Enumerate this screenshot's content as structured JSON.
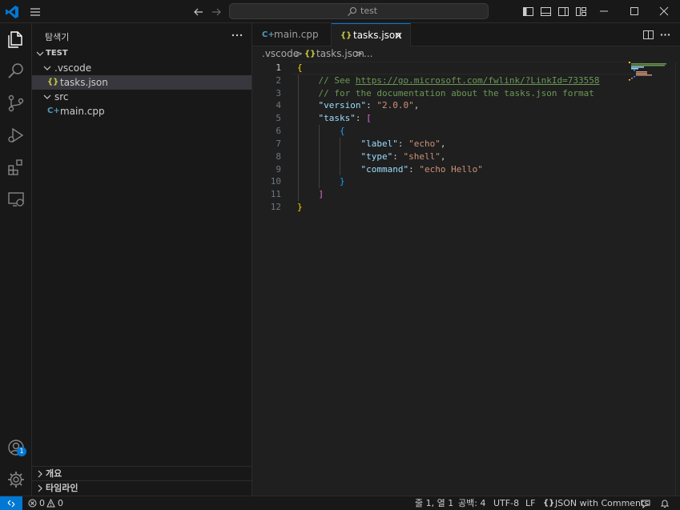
{
  "titlebar": {
    "search_text": "test"
  },
  "activity_bar": {
    "items": [
      "explorer-icon",
      "search-icon",
      "source-control-icon",
      "run-debug-icon",
      "extensions-icon",
      "remote-explorer-icon"
    ],
    "accounts_badge": "1"
  },
  "sidebar": {
    "title": "탐색기",
    "root": "TEST",
    "tree": [
      {
        "label": ".vscode",
        "type": "folder"
      },
      {
        "label": "tasks.json",
        "type": "file",
        "icon": "{}"
      },
      {
        "label": "src",
        "type": "folder"
      },
      {
        "label": "main.cpp",
        "type": "file",
        "icon": "C+"
      }
    ],
    "sections": [
      "개요",
      "타임라인"
    ]
  },
  "tabs": [
    {
      "label": "main.cpp",
      "icon": "C+"
    },
    {
      "label": "tasks.json",
      "icon": "{}",
      "active": true
    }
  ],
  "breadcrumb": {
    "folder": ".vscode",
    "sep1": ">",
    "file_icon": "{}",
    "file": "tasks.json",
    "sep2": ">",
    "more": "..."
  },
  "editor": {
    "line_numbers": [
      "1",
      "2",
      "3",
      "4",
      "5",
      "6",
      "7",
      "8",
      "9",
      "10",
      "11",
      "12"
    ],
    "lines": {
      "l1_brace": "{",
      "l2_comment": "// See ",
      "l2_link": "https://go.microsoft.com/fwlink/?LinkId=733558",
      "l3_comment": "// for the documentation about the tasks.json format",
      "l4_key": "\"version\"",
      "l4_colon": ": ",
      "l4_val": "\"2.0.0\"",
      "l4_comma": ",",
      "l5_key": "\"tasks\"",
      "l5_colon": ": ",
      "l5_bracket": "[",
      "l6_brace": "{",
      "l7_key": "\"label\"",
      "l7_colon": ": ",
      "l7_val": "\"echo\"",
      "l7_comma": ",",
      "l8_key": "\"type\"",
      "l8_colon": ": ",
      "l8_val": "\"shell\"",
      "l8_comma": ",",
      "l9_key": "\"command\"",
      "l9_colon": ": ",
      "l9_val": "\"echo Hello\"",
      "l10_brace": "}",
      "l11_bracket": "]",
      "l12_brace": "}"
    }
  },
  "statusbar": {
    "errors": "0",
    "warnings": "0",
    "position": "줄 1, 열 1",
    "spaces": "공백: 4",
    "encoding": "UTF-8",
    "eol": "LF",
    "language_icon": "{}",
    "language": "JSON with Comments"
  },
  "colors": {
    "accent": "#0078d4",
    "background": "#1f1f1f",
    "sidebar": "#181818"
  }
}
